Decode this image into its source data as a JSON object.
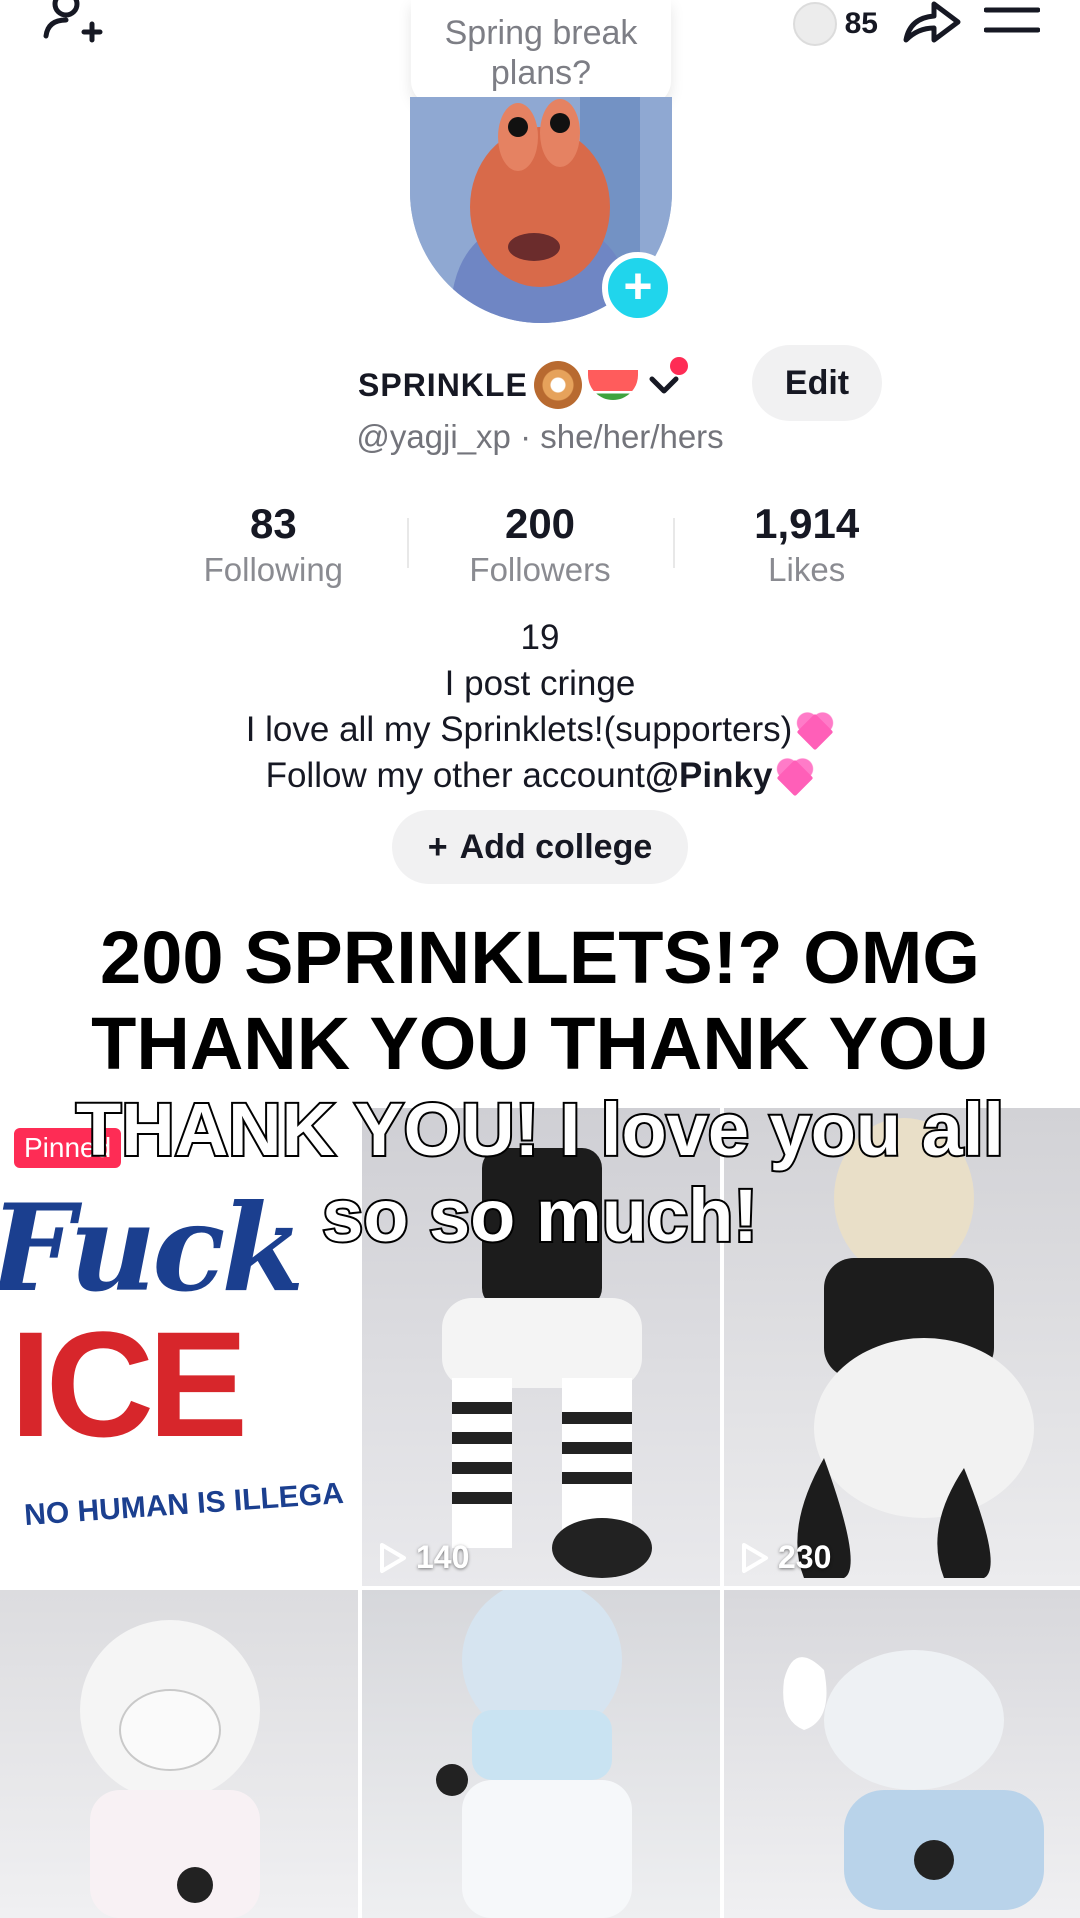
{
  "note": {
    "text": "Spring break plans?"
  },
  "top_bar": {
    "coin_count": "85"
  },
  "profile": {
    "display_name": "SPRINKLE",
    "handle_line": "@yagji_xp · she/her/hers",
    "edit_label": "Edit"
  },
  "stats": [
    {
      "value": "83",
      "label": "Following"
    },
    {
      "value": "200",
      "label": "Followers"
    },
    {
      "value": "1,914",
      "label": "Likes"
    }
  ],
  "bio": {
    "line1": "19",
    "line2": "I post cringe",
    "line3": "I love all my Sprinklets!(supporters)",
    "line4_prefix": "Follow my other account",
    "line4_mention": "@Pinky"
  },
  "college_button": {
    "icon": "+",
    "label": "Add college"
  },
  "videos": [
    {
      "pinned_label": "Pinned",
      "sign_top": "Fuck",
      "sign_main": "ICE",
      "sign_sub": "NO HUMAN IS ILLEGA"
    },
    {
      "views": "140"
    },
    {
      "views": "230"
    },
    {},
    {},
    {}
  ],
  "caption": {
    "line1": "200 SPRINKLETS!? OMG",
    "line2": "THANK YOU THANK YOU",
    "line3": "THANK YOU! I love you all",
    "line4": "so so much!"
  },
  "colors": {
    "accent": "#fe2c55",
    "avatar_add": "#20d5ec",
    "pill_bg": "#f1f1f2"
  }
}
